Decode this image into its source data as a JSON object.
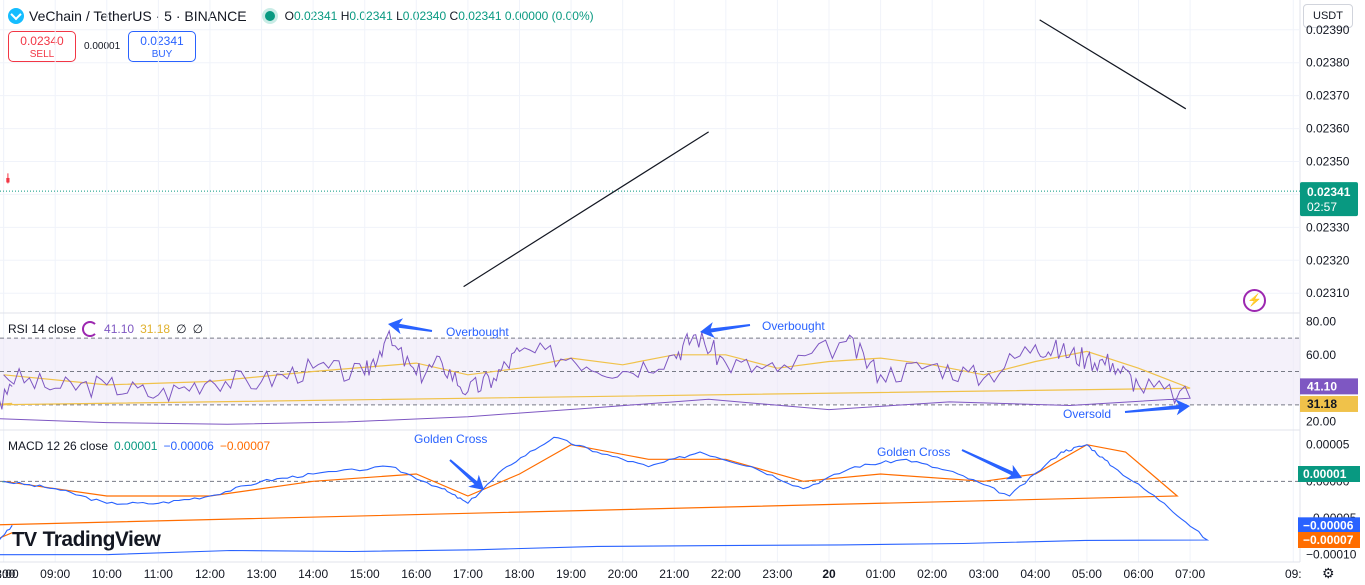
{
  "header": {
    "symbol": "VeChain / TetherUS · 5 · BINANCE",
    "o_label": "O",
    "o": "0.02341",
    "h_label": "H",
    "h": "0.02341",
    "l_label": "L",
    "l": "0.02340",
    "c_label": "C",
    "c": "0.02341",
    "change": "0.00000 (0.00%)"
  },
  "trade": {
    "sell_price": "0.02340",
    "sell_label": "SELL",
    "spread": "0.00001",
    "buy_price": "0.02341",
    "buy_label": "BUY"
  },
  "currency": "USDT",
  "branding": {
    "logo_mark": "TV",
    "name": "TradingView"
  },
  "icons": {
    "flash": "⚡",
    "settings": "⚙"
  },
  "colors": {
    "up": "#089981",
    "down": "#f23645",
    "rsi": "#7e57c2",
    "rsi_ma": "#f0c24a",
    "macd": "#2962ff",
    "signal": "#ff6d00",
    "arrow": "#2962ff"
  },
  "chart_data": [
    {
      "type": "candlestick",
      "title": "VeChain / TetherUS · 5 · BINANCE",
      "ylim": [
        0.02304,
        0.02396
      ],
      "y_ticks": [
        "0.02310",
        "0.02320",
        "0.02330",
        "0.02340",
        "0.02350",
        "0.02360",
        "0.02370",
        "0.02380",
        "0.02390"
      ],
      "x_ticks": [
        "8:00",
        "09:00",
        "10:00",
        "11:00",
        "12:00",
        "13:00",
        "14:00",
        "15:00",
        "16:00",
        "17:00",
        "18:00",
        "19:00",
        "20:00",
        "21:00",
        "22:00",
        "23:00",
        "20",
        "01:00",
        "02:00",
        "03:00",
        "04:00",
        "05:00",
        "06:00",
        "07:00",
        "08:00",
        "09:"
      ],
      "key_points": [
        {
          "t": "08:00",
          "v": 0.02345
        },
        {
          "t": "08:45",
          "v": 0.02333
        },
        {
          "t": "09:10",
          "v": 0.0234
        },
        {
          "t": "09:45",
          "v": 0.0233
        },
        {
          "t": "10:40",
          "v": 0.02322
        },
        {
          "t": "11:10",
          "v": 0.02328
        },
        {
          "t": "12:00",
          "v": 0.02327
        },
        {
          "t": "12:30",
          "v": 0.02323
        },
        {
          "t": "13:10",
          "v": 0.0233
        },
        {
          "t": "14:10",
          "v": 0.02334
        },
        {
          "t": "14:45",
          "v": 0.0233
        },
        {
          "t": "15:20",
          "v": 0.02337
        },
        {
          "t": "15:35",
          "v": 0.02341
        },
        {
          "t": "16:00",
          "v": 0.02328
        },
        {
          "t": "16:30",
          "v": 0.02339
        },
        {
          "t": "16:55",
          "v": 0.02313
        },
        {
          "t": "17:30",
          "v": 0.02327
        },
        {
          "t": "18:00",
          "v": 0.02343
        },
        {
          "t": "18:40",
          "v": 0.02352
        },
        {
          "t": "19:30",
          "v": 0.02347
        },
        {
          "t": "20:00",
          "v": 0.02345
        },
        {
          "t": "20:40",
          "v": 0.02349
        },
        {
          "t": "21:15",
          "v": 0.02358
        },
        {
          "t": "21:35",
          "v": 0.02364
        },
        {
          "t": "21:55",
          "v": 0.02356
        },
        {
          "t": "22:30",
          "v": 0.02357
        },
        {
          "t": "23:00",
          "v": 0.02354
        },
        {
          "t": "23:30",
          "v": 0.0235
        },
        {
          "t": "00:00",
          "v": 0.02353
        },
        {
          "t": "00:15",
          "v": 0.02368
        },
        {
          "t": "00:50",
          "v": 0.02353
        },
        {
          "t": "01:20",
          "v": 0.02364
        },
        {
          "t": "01:50",
          "v": 0.02359
        },
        {
          "t": "02:30",
          "v": 0.02354
        },
        {
          "t": "03:20",
          "v": 0.02354
        },
        {
          "t": "03:45",
          "v": 0.02366
        },
        {
          "t": "04:15",
          "v": 0.02375
        },
        {
          "t": "04:35",
          "v": 0.02382
        },
        {
          "t": "05:00",
          "v": 0.02377
        },
        {
          "t": "05:30",
          "v": 0.02378
        },
        {
          "t": "05:55",
          "v": 0.02366
        },
        {
          "t": "06:20",
          "v": 0.02363
        },
        {
          "t": "06:40",
          "v": 0.0236
        },
        {
          "t": "06:55",
          "v": 0.0235
        },
        {
          "t": "07:15",
          "v": 0.02338
        },
        {
          "t": "07:35",
          "v": 0.0233
        },
        {
          "t": "07:55",
          "v": 0.02337
        },
        {
          "t": "08:10",
          "v": 0.02341
        }
      ],
      "current_price": "0.02341",
      "countdown": "02:57",
      "resistance_zone": [
        0.02379,
        0.02382
      ],
      "support_zone": [
        0.02341,
        0.02343
      ],
      "trendlines": [
        {
          "from": {
            "t": "16:55",
            "v": 0.02312
          },
          "to": {
            "t": "21:40",
            "v": 0.02359
          }
        },
        {
          "from": {
            "t": "04:05",
            "v": 0.02393
          },
          "to": {
            "t": "06:55",
            "v": 0.02366
          }
        }
      ]
    },
    {
      "type": "line",
      "title": "RSI 14 close",
      "values_label": [
        "41.10",
        "31.18",
        "∅",
        "∅"
      ],
      "ylim": [
        15,
        85
      ],
      "y_ticks": [
        "80.00",
        "60.00",
        "20.00"
      ],
      "bands": [
        30,
        50,
        70
      ],
      "series": [
        {
          "name": "RSI",
          "current": "41.10",
          "points": [
            {
              "t": "08:00",
              "v": 48
            },
            {
              "t": "09:00",
              "v": 40
            },
            {
              "t": "10:00",
              "v": 42
            },
            {
              "t": "11:00",
              "v": 36
            },
            {
              "t": "12:00",
              "v": 45
            },
            {
              "t": "13:00",
              "v": 44
            },
            {
              "t": "14:00",
              "v": 52
            },
            {
              "t": "15:00",
              "v": 48
            },
            {
              "t": "15:25",
              "v": 70
            },
            {
              "t": "16:00",
              "v": 48
            },
            {
              "t": "16:30",
              "v": 55
            },
            {
              "t": "17:00",
              "v": 38
            },
            {
              "t": "17:30",
              "v": 46
            },
            {
              "t": "18:00",
              "v": 62
            },
            {
              "t": "19:00",
              "v": 58
            },
            {
              "t": "20:00",
              "v": 50
            },
            {
              "t": "21:00",
              "v": 60
            },
            {
              "t": "21:25",
              "v": 72
            },
            {
              "t": "22:00",
              "v": 55
            },
            {
              "t": "23:00",
              "v": 50
            },
            {
              "t": "00:20",
              "v": 68
            },
            {
              "t": "01:00",
              "v": 48
            },
            {
              "t": "02:00",
              "v": 54
            },
            {
              "t": "03:00",
              "v": 46
            },
            {
              "t": "04:00",
              "v": 66
            },
            {
              "t": "04:30",
              "v": 62
            },
            {
              "t": "05:00",
              "v": 58
            },
            {
              "t": "05:30",
              "v": 55
            },
            {
              "t": "06:00",
              "v": 42
            },
            {
              "t": "07:00",
              "v": 34
            },
            {
              "t": "07:40",
              "v": 22
            },
            {
              "t": "08:10",
              "v": 41
            }
          ]
        },
        {
          "name": "RSI MA",
          "current": "31.18",
          "points": [
            {
              "t": "08:00",
              "v": 48
            },
            {
              "t": "10:00",
              "v": 42
            },
            {
              "t": "12:00",
              "v": 44
            },
            {
              "t": "14:00",
              "v": 50
            },
            {
              "t": "16:00",
              "v": 55
            },
            {
              "t": "17:00",
              "v": 48
            },
            {
              "t": "18:00",
              "v": 52
            },
            {
              "t": "19:00",
              "v": 58
            },
            {
              "t": "20:00",
              "v": 54
            },
            {
              "t": "21:00",
              "v": 60
            },
            {
              "t": "22:00",
              "v": 60
            },
            {
              "t": "23:00",
              "v": 52
            },
            {
              "t": "00:00",
              "v": 56
            },
            {
              "t": "01:00",
              "v": 58
            },
            {
              "t": "02:00",
              "v": 54
            },
            {
              "t": "03:00",
              "v": 48
            },
            {
              "t": "04:00",
              "v": 56
            },
            {
              "t": "05:00",
              "v": 62
            },
            {
              "t": "06:00",
              "v": 52
            },
            {
              "t": "07:00",
              "v": 40
            },
            {
              "t": "07:45",
              "v": 30
            },
            {
              "t": "08:10",
              "v": 31
            }
          ]
        }
      ],
      "annotations": [
        "Overbought",
        "Overbought",
        "Oversold"
      ]
    },
    {
      "type": "bar+line",
      "title": "MACD 12 26 close",
      "values_label": [
        "0.00001",
        "−0.00006",
        "−0.00007"
      ],
      "ylim": [
        -0.00011,
        7e-05
      ],
      "y_ticks": [
        "0.00005",
        "0.00000",
        "−0.00005",
        "−0.00010"
      ],
      "series": [
        {
          "name": "MACD",
          "current": "−0.00006",
          "points": [
            {
              "t": "08:00",
              "v": 0
            },
            {
              "t": "09:00",
              "v": -1e-05
            },
            {
              "t": "10:00",
              "v": -3e-05
            },
            {
              "t": "11:00",
              "v": -3e-05
            },
            {
              "t": "12:00",
              "v": -2e-05
            },
            {
              "t": "13:00",
              "v": 0
            },
            {
              "t": "14:00",
              "v": 1e-05
            },
            {
              "t": "15:30",
              "v": 2e-05
            },
            {
              "t": "16:30",
              "v": -1e-05
            },
            {
              "t": "17:00",
              "v": -3e-05
            },
            {
              "t": "17:45",
              "v": 2e-05
            },
            {
              "t": "18:40",
              "v": 6e-05
            },
            {
              "t": "19:30",
              "v": 4e-05
            },
            {
              "t": "20:30",
              "v": 2e-05
            },
            {
              "t": "21:30",
              "v": 4e-05
            },
            {
              "t": "22:30",
              "v": 2e-05
            },
            {
              "t": "23:30",
              "v": -1e-05
            },
            {
              "t": "00:30",
              "v": 2e-05
            },
            {
              "t": "01:30",
              "v": 3e-05
            },
            {
              "t": "02:30",
              "v": 1e-05
            },
            {
              "t": "03:30",
              "v": -2e-05
            },
            {
              "t": "04:30",
              "v": 4e-05
            },
            {
              "t": "05:00",
              "v": 5e-05
            },
            {
              "t": "05:30",
              "v": 2e-05
            },
            {
              "t": "06:30",
              "v": -3e-05
            },
            {
              "t": "07:20",
              "v": -8e-05
            },
            {
              "t": "07:40",
              "v": -0.0001
            },
            {
              "t": "08:10",
              "v": -6e-05
            }
          ]
        },
        {
          "name": "Signal",
          "current": "−0.00007",
          "points": [
            {
              "t": "08:00",
              "v": 0
            },
            {
              "t": "10:00",
              "v": -2e-05
            },
            {
              "t": "12:00",
              "v": -2e-05
            },
            {
              "t": "14:00",
              "v": 0
            },
            {
              "t": "16:00",
              "v": 1e-05
            },
            {
              "t": "17:00",
              "v": -2e-05
            },
            {
              "t": "18:00",
              "v": 1e-05
            },
            {
              "t": "19:00",
              "v": 5e-05
            },
            {
              "t": "20:30",
              "v": 3e-05
            },
            {
              "t": "22:00",
              "v": 3e-05
            },
            {
              "t": "23:30",
              "v": 0
            },
            {
              "t": "01:00",
              "v": 1e-05
            },
            {
              "t": "03:00",
              "v": 0
            },
            {
              "t": "04:00",
              "v": 1e-05
            },
            {
              "t": "05:00",
              "v": 5e-05
            },
            {
              "t": "05:45",
              "v": 4e-05
            },
            {
              "t": "06:45",
              "v": -2e-05
            },
            {
              "t": "07:30",
              "v": -6e-05
            },
            {
              "t": "07:50",
              "v": -8e-05
            },
            {
              "t": "08:10",
              "v": -7e-05
            }
          ]
        },
        {
          "name": "Histogram",
          "current": "0.00001"
        }
      ],
      "annotations": [
        "Golden Cross",
        "Golden Cross"
      ]
    }
  ]
}
